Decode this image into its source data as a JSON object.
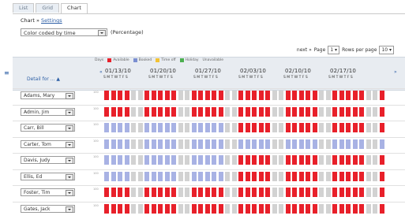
{
  "tabs": [
    {
      "label": "List"
    },
    {
      "label": "Grid"
    },
    {
      "label": "Chart"
    }
  ],
  "breadcrumb": {
    "current": "Chart",
    "separator": "»",
    "link": "Settings"
  },
  "controls": {
    "color_by": "Color coded by time",
    "percentage_label": "(Percentage)"
  },
  "pager": {
    "next_label": "next »",
    "page_label": "Page",
    "page_value": "1",
    "rows_label": "Rows per page",
    "rows_value": "10"
  },
  "legend": [
    {
      "label": "Days",
      "color": ""
    },
    {
      "label": "Available",
      "color": "#e8202a"
    },
    {
      "label": "Booked",
      "color": "#7b8fd1"
    },
    {
      "label": "Time off",
      "color": "#f2c233"
    },
    {
      "label": "Holiday",
      "color": "#4caf50"
    },
    {
      "label": "Unavailable",
      "color": ""
    }
  ],
  "detail_header": "Detail for ... ▲",
  "nav": {
    "prev": "«",
    "next": "»"
  },
  "weeks": [
    "01/13/10",
    "01/20/10",
    "01/27/10",
    "02/03/10",
    "02/10/10",
    "02/17/10"
  ],
  "day_letters": "S M T W T F S",
  "people": [
    {
      "name": "Adams, Mary"
    },
    {
      "name": "Admin, Jim"
    },
    {
      "name": "Carr, Bill"
    },
    {
      "name": "Carter, Tom"
    },
    {
      "name": "Davis, Judy"
    },
    {
      "name": "Ellis, Ed"
    },
    {
      "name": "Foster, Tim"
    },
    {
      "name": "Gates, Jack"
    }
  ],
  "hours_label": "100",
  "colors": {
    "available": "#e8202a",
    "booked": "#a8b2e4",
    "weekend": "#d2d2d2",
    "tabbar": "#e8ecf1"
  },
  "rows": [
    {
      "pattern": "RRRRGGRRRRRGGRRRRRGGRRRRRGGRRRRRGGRRRRRGGR"
    },
    {
      "pattern": "RRRRGGRRRRRGGRRRRRGGRRRRRGGRRRRRGGRRRRRGGR"
    },
    {
      "pattern": "BBBBGGBBBBBGGBBBBBGGRRRRRGGRRRRRGGRRRRRGGR"
    },
    {
      "pattern": "BBBBGGBBBBBGGBBBBBGGBBBBBGGBBBBBGGBBBBBGGB"
    },
    {
      "pattern": "BBBBGGBBBBBGGBBBBBGGRRRRRGGRRRRRGGRRRRRGGR"
    },
    {
      "pattern": "BBBBGGBBBBBGGBBBBBGGRRRRRGGRRRRRGGRRRRRGGR"
    },
    {
      "pattern": "RRRRGGRRRRRGGRRRRRGGRRRRRGGRRRRRGGRRRRRGGR"
    },
    {
      "pattern": "RRRRGGRRRRRGGRRRRRGGRRRRRGGRRRRRGGRRRRRGGR"
    }
  ]
}
